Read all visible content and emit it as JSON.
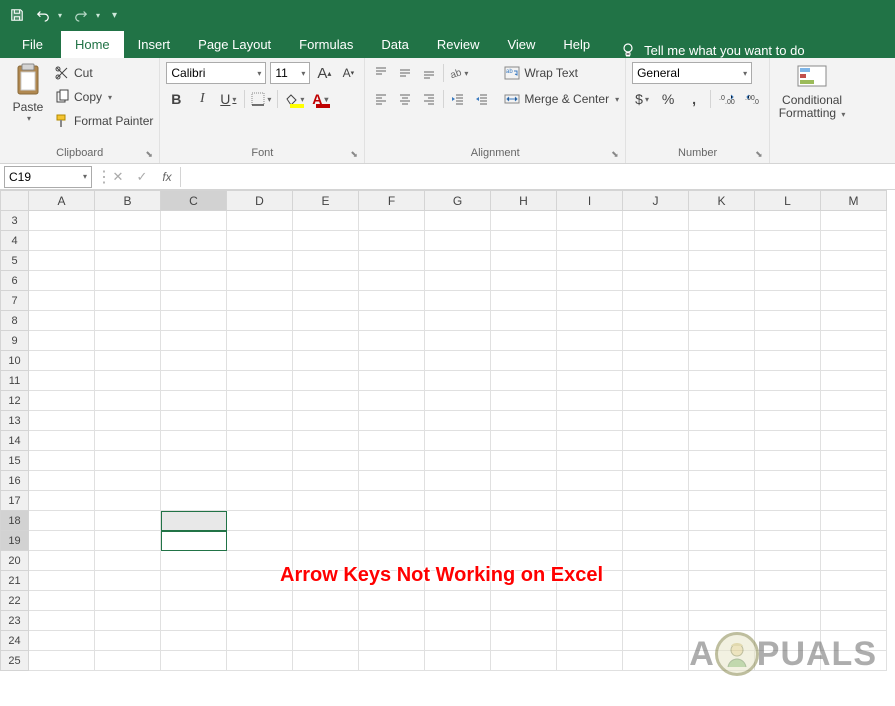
{
  "quickAccess": {
    "save": "Save",
    "undo": "Undo",
    "redo": "Redo"
  },
  "tabs": {
    "file": "File",
    "home": "Home",
    "insert": "Insert",
    "pageLayout": "Page Layout",
    "formulas": "Formulas",
    "data": "Data",
    "review": "Review",
    "view": "View",
    "help": "Help",
    "tellMe": "Tell me what you want to do"
  },
  "ribbon": {
    "clipboard": {
      "label": "Clipboard",
      "paste": "Paste",
      "cut": "Cut",
      "copy": "Copy",
      "formatPainter": "Format Painter"
    },
    "font": {
      "label": "Font",
      "name": "Calibri",
      "size": "11",
      "increaseA": "A",
      "decreaseA": "A",
      "bold": "B",
      "italic": "I",
      "underline": "U"
    },
    "alignment": {
      "label": "Alignment",
      "wrapText": "Wrap Text",
      "mergeCenter": "Merge & Center"
    },
    "number": {
      "label": "Number",
      "format": "General",
      "currency": "$",
      "percent": "%",
      "comma": ",",
      "incDec": "Increase Decimal",
      "decDec": "Decrease Decimal"
    },
    "styles": {
      "conditional": "Conditional",
      "formatting": "Formatting"
    }
  },
  "formulaBar": {
    "nameBox": "C19",
    "cancel": "✕",
    "enter": "✓",
    "fx": "fx"
  },
  "grid": {
    "columns": [
      "A",
      "B",
      "C",
      "D",
      "E",
      "F",
      "G",
      "H",
      "I",
      "J",
      "K",
      "L",
      "M"
    ],
    "rowsStart": 3,
    "rowsEnd": 25,
    "selectedCell": "C19",
    "selectedCol": "C",
    "selectedRowFrom": 18,
    "selectedRowTo": 19
  },
  "overlay": "Arrow Keys Not Working on Excel",
  "watermark": {
    "prefix": "A",
    "suffix": "PUALS"
  }
}
